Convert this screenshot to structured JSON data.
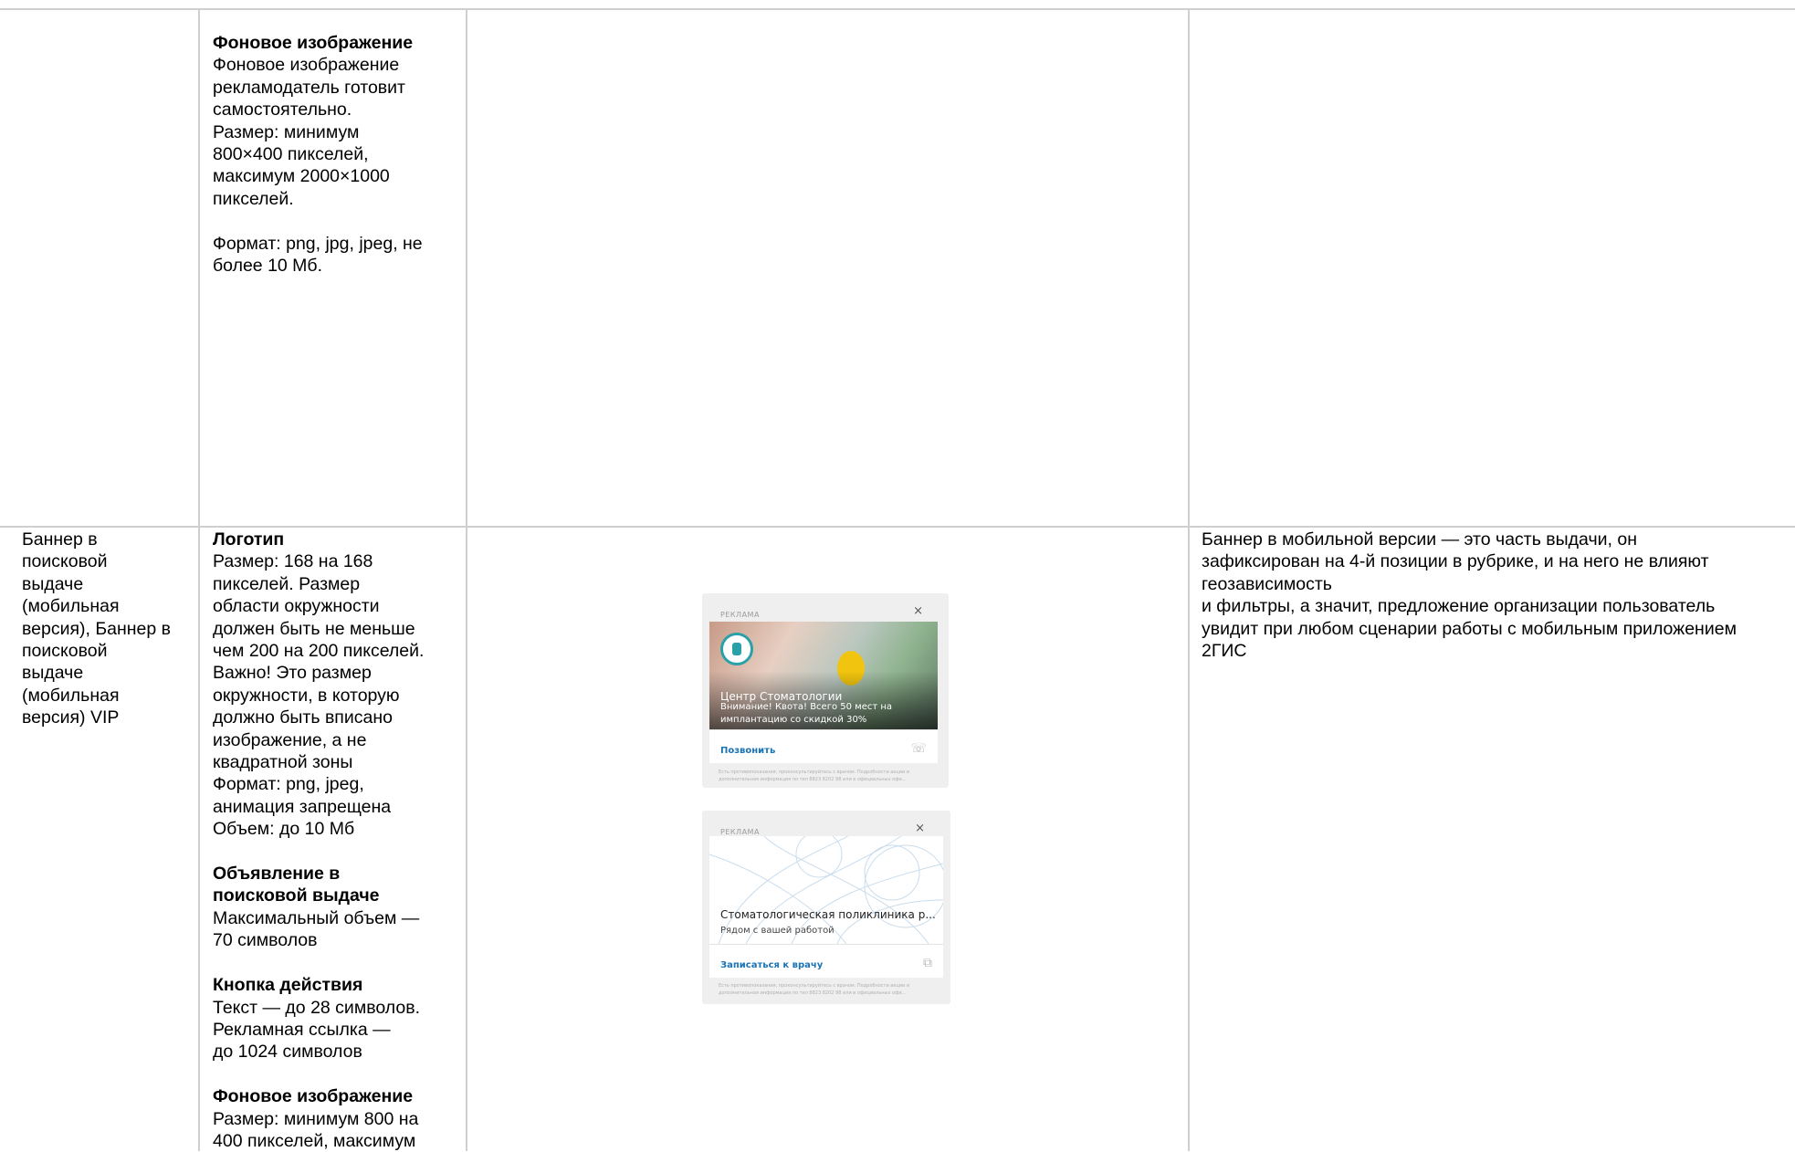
{
  "row1": {
    "col2": [
      {
        "title": "Фоновое изображение",
        "lines": [
          "Фоновое изображение",
          "рекламодатель готовит",
          "самостоятельно.",
          "Размер: минимум",
          "800×400 пикселей,",
          "максимум 2000×1000",
          "пикселей."
        ]
      },
      {
        "lines": [
          "Формат: png, jpg, jpeg, не",
          "более 10 Мб."
        ]
      }
    ]
  },
  "row2": {
    "col1": [
      "Баннер в",
      "поисковой",
      "выдаче",
      "(мобильная",
      "версия), Баннер в",
      "поисковой",
      "выдаче",
      "(мобильная",
      "версия) VIP"
    ],
    "col2": [
      {
        "title": "Логотип",
        "lines": [
          "Размер: 168 на 168",
          "пикселей. Размер",
          "области окружности",
          "должен быть не меньше",
          "чем 200 на 200 пикселей.",
          "Важно! Это размер",
          "окружности, в которую",
          "должно быть вписано",
          "изображение, а не",
          "квадратной зоны",
          "Формат: png, jpeg,",
          "анимация запрещена",
          "Объем: до 10 Мб"
        ]
      },
      {
        "title": "Объявление в поисковой выдаче",
        "title_lines": [
          "Объявление в",
          "поисковой выдаче"
        ],
        "lines": [
          "Максимальный объем —",
          "70 символов"
        ]
      },
      {
        "title": "Кнопка действия",
        "lines": [
          "Текст — до 28 символов.",
          "Рекламная ссылка —",
          "до 1024 символов"
        ]
      },
      {
        "title": "Фоновое изображение",
        "lines": [
          "Размер: минимум 800 на",
          "400 пикселей, максимум"
        ]
      }
    ],
    "col4": [
      "Баннер в мобильной версии — это часть выдачи, он",
      "зафиксирован на 4-й позиции в рубрике, и на него не влияют",
      "геозависимость",
      "и фильтры, а значит, предложение организации пользователь",
      "увидит при любом сценарии работы с мобильным приложением",
      "2ГИС"
    ],
    "ad1": {
      "tag": "РЕКЛАМА",
      "close": "×",
      "title": "Центр Стоматологии",
      "desc": "Внимание! Квота! Всего 50 мест на имплантацию со скидкой 30%",
      "cta": "Позвонить",
      "cta_icon": "phone-icon",
      "fine": "Есть противопоказания, проконсультируйтесь с врачом. Подробности акции и дополнительная информация по тел 8823 8202 98 или в официальных офи..."
    },
    "ad2": {
      "tag": "РЕКЛАМА",
      "close": "×",
      "title": "Стоматологическая поликлиника р...",
      "desc": "Рядом с вашей работой",
      "cta": "Записаться к врачу",
      "cta_icon": "external-link-icon",
      "fine": "Есть противопоказания, проконсультируйтесь с врачом. Подробности акции и дополнительная информация по тел 8823 8202 98 или в официальных офи..."
    }
  }
}
